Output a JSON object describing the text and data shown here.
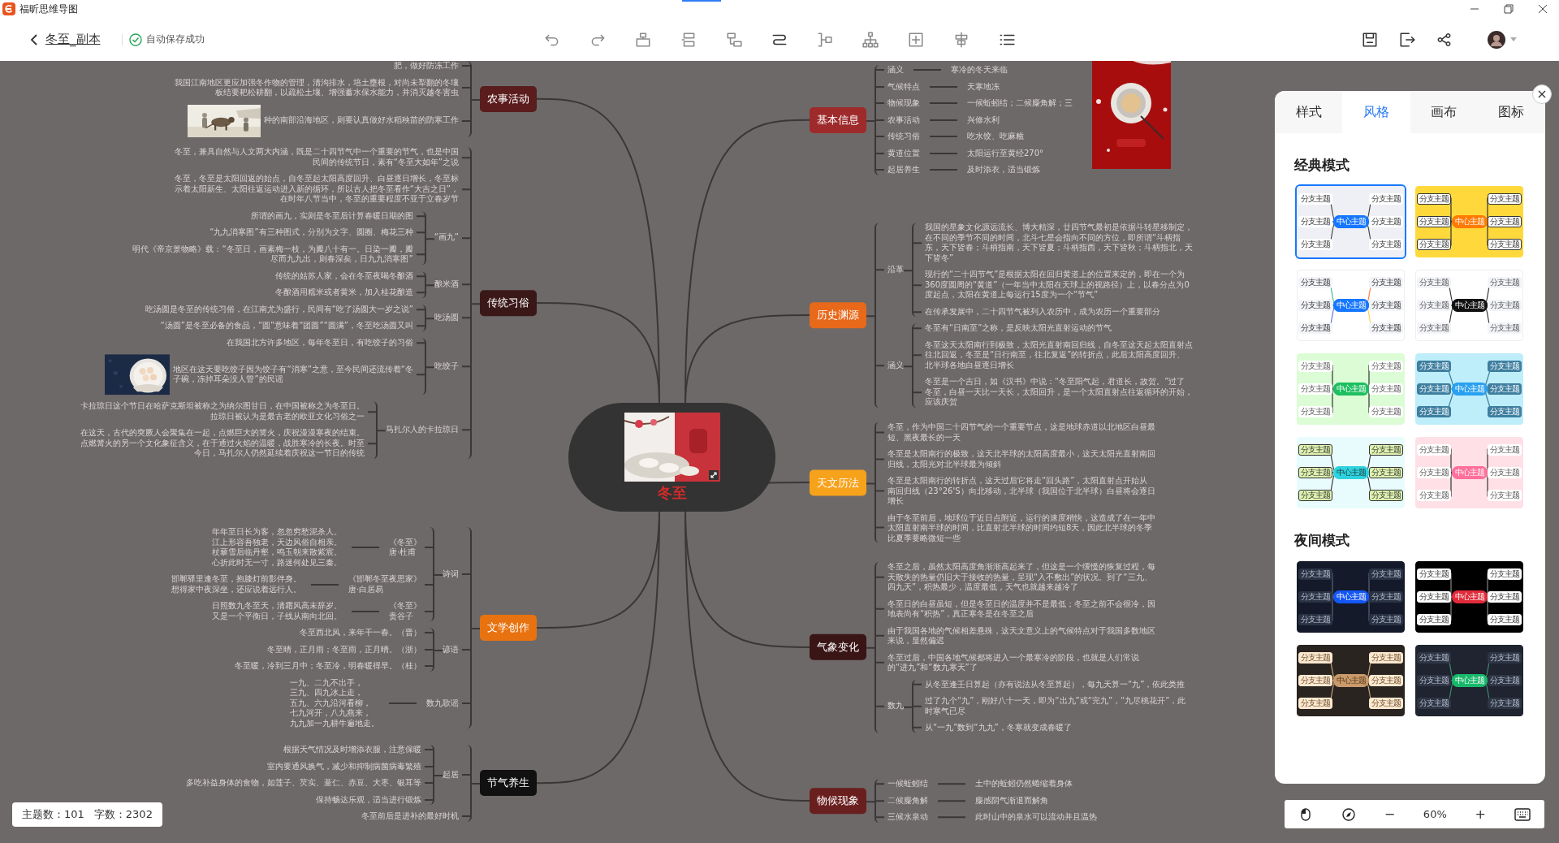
{
  "app": {
    "title": "福昕思维导图"
  },
  "toolbar": {
    "doc_title": "冬至_副本",
    "save_status": "自动保存成功"
  },
  "mindmap": {
    "center": "冬至",
    "left_branches": [
      {
        "text": "农事活动",
        "color": "#5a1c1c",
        "children": [
          {
            "text": "肥，做好防冻工作"
          },
          {
            "text": "我国江南地区更应加强冬作物的管理，清沟排水，培土壅根，对尚未犁翻的冬壤板结要耙松耕翻，以疏松土壤、增强蓄水保水能力，并消灭越冬害虫"
          },
          {
            "text": "种的南部沿海地区，则要认真做好水稻秧苗的防寒工作",
            "kind": "with_picture"
          }
        ]
      },
      {
        "text": "传统习俗",
        "color": "#3b1818",
        "children": [
          {
            "text": "冬至，兼具自然与人文两大内涵，既是二十四节气中一个重要的节气，也是中国民间的传统节日，素有“冬至大如年”之说"
          },
          {
            "text": "冬至，冬至是太阳回返的始点，自冬至起太阳高度回升、白昼逐日增长，冬至标示着太阳新生、太阳往返运动进入新的循环，所以古人把冬至看作“大吉之日”，在时年八节当中，冬至的重要程度不亚于立春岁节"
          },
          {
            "text": "“画九”",
            "children": [
              {
                "text": "所谓的画九，实则是冬至后计算春暖日期的图"
              },
              {
                "text": "“九九消寒图”有三种图式，分别为文字、圆圈、梅花三种"
              },
              {
                "text": "明代《帝京景物略》载：“冬至日，画素梅一枝，为瓣八十有一。日染一瓣，瓣尽而九九出，则春深矣，日九九消寒图”"
              }
            ]
          },
          {
            "text": "酿米酒",
            "children": [
              {
                "text": "传统的姑苏人家，会在冬至夜喝冬酿酒"
              },
              {
                "text": "冬酿酒用糯米或者黄米，加入桂花酿造"
              }
            ]
          },
          {
            "text": "吃汤圆",
            "children": [
              {
                "text": "吃汤圆是冬至的传统习俗，在江南尤为盛行，民间有“吃了汤圆大一岁之说”"
              },
              {
                "text": "“汤圆”是冬至必备的食品，“圆”意味着“团圆”“圆满”，冬至吃汤圆又叫"
              }
            ]
          },
          {
            "text": "吃饺子",
            "children": [
              {
                "text": "在我国北方许多地区，每年冬至日，有吃饺子的习俗"
              },
              {
                "lines": [
                  "地区在这天要吃饺子因为饺子有“消寒”之意，至今民间还流传着“冬",
                  "子碗，冻掉耳朵没人管”的民谣"
                ],
                "kind": "with_picture"
              }
            ]
          },
          {
            "text": "马扎尔人的卡拉琼日",
            "children": [
              {
                "text": "卡拉琼日这个节日在哈萨克斯坦被称之为纳尔图甘日，在中国被称之为冬至日。拉琼日被认为是最古老的欧亚文化习俗之一"
              },
              {
                "text": "在这天，古代的突厥人会聚集在一起，点燃巨大的篝火，庆祝漫漫寒夜的结束。点燃篝火的另一个文化象征含义，在于通过火焰的温暖，战胜寒冷的长夜。时至今日，马扎尔人仍然延续着庆祝这一节日的传统"
              }
            ]
          }
        ]
      },
      {
        "text": "文学创作",
        "color": "#e8720f",
        "children": [
          {
            "text": "诗词",
            "children": [
              {
                "lines": [
                  "《冬至》",
                  "唐·杜甫"
                ],
                "children": [
                  {
                    "lines": [
                      "年年至日长为客，忽忽穷愁泥杀人。",
                      "江上形容吾独老，天边风俗自相亲。",
                      "杖藜雪后临丹壑，鸣玉朝来散紫宸。",
                      "心折此时无一寸，路迷何处见三秦。"
                    ]
                  }
                ]
              },
              {
                "lines": [
                  "《邯郸冬至夜思家》",
                  "唐·白居易"
                ],
                "children": [
                  {
                    "lines": [
                      "邯郸驿里逢冬至，抱膝灯前影伴身。",
                      "想得家中夜深坐，还应说着远行人。"
                    ]
                  }
                ]
              },
              {
                "lines": [
                  "《冬至》",
                  "贵谷子"
                ],
                "children": [
                  {
                    "lines": [
                      "日照数九冬至天，清霜风高未辞岁。",
                      "又是一个平衡日，子线从南向北回。"
                    ]
                  }
                ]
              }
            ]
          },
          {
            "text": "谚语",
            "children": [
              {
                "text": "冬至西北风，来年干一春。（晋）"
              },
              {
                "text": "冬至晴，正月雨；冬至雨，正月晴。（浙）"
              },
              {
                "text": "冬至暖，冷到三月中；冬至冷，明春暖得早。（桂）"
              }
            ]
          },
          {
            "text": "数九歌谣",
            "children": [
              {
                "lines": [
                  "一九、二九不出手，",
                  "三九、四九冰上走，",
                  "五九、六九沿河看柳，",
                  "七九河开，八九燕来，",
                  "九九加一九耕牛遍地走。"
                ]
              }
            ]
          }
        ]
      },
      {
        "text": "节气养生",
        "color": "#111111",
        "children": [
          {
            "text": "起居",
            "children": [
              {
                "text": "根据天气情况及时增添衣服，注意保暖"
              },
              {
                "text": "室内要通风换气，减少和抑制病菌病毒繁殖"
              },
              {
                "text": "多吃补益身体的食物，如莲子、芡实、薏仁、赤豆、大枣、银耳等"
              },
              {
                "text": "保持畅达乐观，适当进行锻炼"
              }
            ]
          },
          {
            "text": "冬至前后是进补的最好时机"
          }
        ]
      }
    ],
    "right_branches": [
      {
        "text": "基本信息",
        "color": "#9e2a2b",
        "children": [
          {
            "text": "涵义",
            "children": [
              {
                "text": "寒冷的冬天来临"
              }
            ]
          },
          {
            "text": "气候特点",
            "children": [
              {
                "text": "天寒地冻"
              }
            ]
          },
          {
            "text": "物候现象",
            "children": [
              {
                "text": "一候蚯蚓结；二候麋角解；三"
              }
            ]
          },
          {
            "text": "农事活动",
            "children": [
              {
                "text": "兴修水利"
              }
            ]
          },
          {
            "text": "传统习俗",
            "children": [
              {
                "text": "吃水饺、吃麻糍"
              }
            ]
          },
          {
            "text": "黄道位置",
            "children": [
              {
                "text": "太阳运行至黄经270°"
              }
            ]
          },
          {
            "text": "起居养生",
            "children": [
              {
                "text": "及时添衣，适当锻炼"
              }
            ]
          }
        ]
      },
      {
        "text": "历史渊源",
        "color": "#e8691a",
        "children": [
          {
            "text": "沿革",
            "children": [
              {
                "text": "我国的星象文化源远流长、博大精深，廿四节气最初是依据斗转星移制定，在不同的季节不同的时间，北斗七星会指向不同的方位，即所谓“斗柄指东，天下皆春；斗柄指南，天下皆夏；斗柄指西，天下皆秋；斗柄指北，天下皆冬”"
              },
              {
                "text": "现行的“二十四节气”是根据太阳在回归黄道上的位置来定的，即在一个为360度圆周的“黄道”（一年当中太阳在天球上的视路径）上，以春分点为0度起点，太阳在黄道上每运行15度为一个“节气”"
              },
              {
                "text": "在传承发展中，二十四节气被列入农历中，成为农历一个重要部分"
              }
            ]
          },
          {
            "text": "涵义",
            "children": [
              {
                "text": "冬至有“日南至”之称，是反映太阳光直射运动的节气"
              },
              {
                "text": "冬至这天太阳南行到极致，太阳光直射南回归线，自冬至这天起太阳直射点往北回返，冬至是“日行南至，往北复返”的转折点，此后太阳高度回升、北半球各地白昼逐日增长"
              },
              {
                "text": "冬至是一个吉日，如《汉书》中说：“冬至阳气起，君道长，故贺。”过了冬至，白昼一天比一天长，太阳回升，是一个太阳直射点往返循环的开始，应该庆贺"
              }
            ]
          }
        ]
      },
      {
        "text": "天文历法",
        "color": "#f7a21b",
        "children": [
          {
            "text": "冬至，作为中国二十四节气的一个重要节点，这是地球赤道以北地区白昼最短、黑夜最长的一天"
          },
          {
            "text": "冬至是太阳南行的极致，这天北半球的太阳高度最小，这天太阳光直射南回归线，太阳光对北半球最为倾斜"
          },
          {
            "text": "冬至是太阳南行的转折点，这天过后它将走“回头路”，太阳直射点开始从南回归线（23°26'S）向北移动，北半球（我国位于北半球）白昼将会逐日增长"
          },
          {
            "text": "由于冬至前后，地球位于近日点附近，运行的速度稍快，这造成了在一年中太阳直射南半球的时间，比直射北半球的时间约短8天，因此北半球的冬季比夏季要略微短一些"
          }
        ]
      },
      {
        "text": "气象变化",
        "color": "#3a1515",
        "children": [
          {
            "text": "冬至之后，虽然太阳高度角渐渐高起来了，但这是一个缓慢的恢复过程，每天散失的热量仍旧大于接收的热量，呈现“入不敷出”的状况。到了“三九、四九天”，积热最少，温度最低，天气也就越来越冷了"
          },
          {
            "text": "冬至日的白昼虽短，但是冬至日的温度并不是最低；冬至之前不会很冷，因地表尚有“积热”，真正寒冬是在冬至之后"
          },
          {
            "text": "由于我国各地的气候相差悬殊，这天文意义上的气候特点对于我国多数地区来说，显然偏迟"
          },
          {
            "text": "冬至过后，中国各地气候都将进入一个最寒冷的阶段，也就是人们常说的“进九”和“数九寒天”了"
          },
          {
            "text": "数九",
            "children": [
              {
                "text": "从冬至逢壬日算起（亦有说法从冬至算起），每九天算一“九”，依此类推"
              },
              {
                "text": "过了九个“九”，刚好八十一天，即为“出九”或“完九”，“九尽桃花开”，此时寒气已尽"
              },
              {
                "text": "从“一九”数到“九九”，冬寒就变成春暖了"
              }
            ]
          }
        ]
      },
      {
        "text": "物候现象",
        "color": "#6a1f1f",
        "children": [
          {
            "text": "一候蚯蚓结",
            "children": [
              {
                "text": "土中的蚯蚓仍然蜷缩着身体"
              }
            ]
          },
          {
            "text": "二候麋角解",
            "children": [
              {
                "text": "麋感阴气渐退而解角"
              }
            ]
          },
          {
            "text": "三候水泉动",
            "children": [
              {
                "text": "此时山中的泉水可以流动并且温热"
              }
            ]
          }
        ]
      }
    ]
  },
  "status": {
    "topics": "主题数：101",
    "words": "字数：2302"
  },
  "panel": {
    "tabs": [
      {
        "label": "样式",
        "selected": false
      },
      {
        "label": "风格",
        "selected": true
      },
      {
        "label": "画布",
        "selected": false
      },
      {
        "label": "图标",
        "selected": false
      }
    ],
    "sections": [
      {
        "title": "经典模式",
        "themes": [
          {
            "center": "中心主题",
            "branches": [
              "分支主题",
              "分支主题",
              "分支主题",
              "分支主题",
              "分支主题",
              "分支主题"
            ],
            "selected": true
          },
          {
            "center": "中心主题",
            "branches": [
              "分支主题",
              "分支主题",
              "分支主题",
              "分支主题",
              "分支主题",
              "分支主题"
            ],
            "selected": false
          },
          {
            "center": "中心主题",
            "branches": [
              "分支主题",
              "分支主题",
              "分支主题",
              "分支主题",
              "分支主题",
              "分支主题"
            ],
            "selected": false
          },
          {
            "center": "中心主题",
            "branches": [
              "分支主题",
              "分支主题",
              "分支主题",
              "分支主题",
              "分支主题",
              "分支主题"
            ],
            "selected": false
          },
          {
            "center": "中心主题",
            "branches": [
              "分支主题",
              "分支主题",
              "分支主题",
              "分支主题",
              "分支主题",
              "分支主题"
            ],
            "selected": false
          },
          {
            "center": "中心主题",
            "branches": [
              "分支主题",
              "分支主题",
              "分支主题",
              "分支主题",
              "分支主题",
              "分支主题"
            ],
            "selected": false
          },
          {
            "center": "中心主题",
            "branches": [
              "分支主题",
              "分支主题",
              "分支主题",
              "分支主题",
              "分支主题",
              "分支主题"
            ],
            "selected": false
          },
          {
            "center": "中心主题",
            "branches": [
              "分支主题",
              "分支主题",
              "分支主题",
              "分支主题",
              "分支主题",
              "分支主题"
            ],
            "selected": false
          }
        ]
      },
      {
        "title": "夜间模式",
        "themes": [
          {
            "center": "中心主题",
            "branches": [
              "分支主题",
              "分支主题",
              "分支主题",
              "分支主题",
              "分支主题",
              "分支主题"
            ],
            "selected": false
          },
          {
            "center": "中心主题",
            "branches": [
              "分支主题",
              "分支主题",
              "分支主题",
              "分支主题",
              "分支主题",
              "分支主题"
            ],
            "selected": false
          },
          {
            "center": "中心主题",
            "branches": [
              "分支主题",
              "分支主题",
              "分支主题",
              "分支主题",
              "分支主题",
              "分支主题"
            ],
            "selected": false
          },
          {
            "center": "中心主题",
            "branches": [
              "分支主题",
              "分支主题",
              "分支主题",
              "分支主题",
              "分支主题",
              "分支主题"
            ],
            "selected": false
          }
        ]
      }
    ]
  },
  "zoom": {
    "minus": "−",
    "level": "60%",
    "plus": "+"
  }
}
